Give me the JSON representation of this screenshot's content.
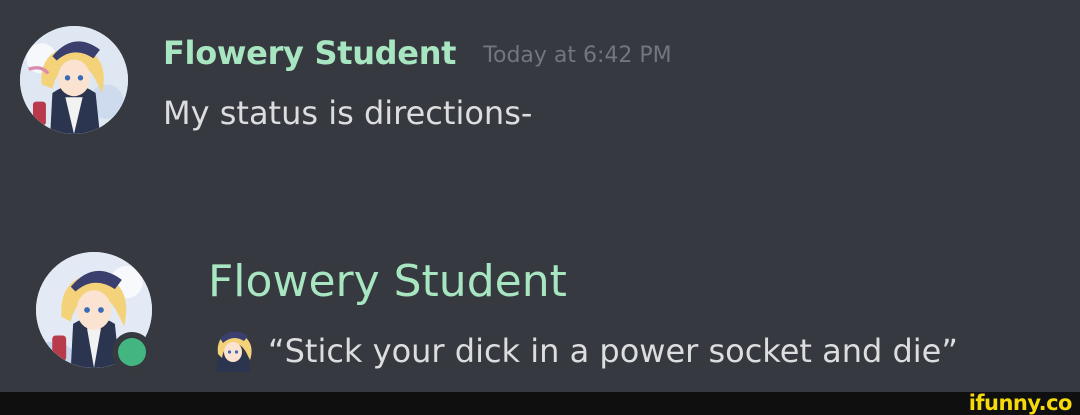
{
  "message": {
    "username": "Flowery Student",
    "timestamp": "Today at 6:42 PM",
    "content": "My status is directions-",
    "avatar_icon": "anime-character-avatar",
    "username_color": "#a8e6c2"
  },
  "profile": {
    "username": "Flowery Student",
    "avatar_icon": "anime-character-avatar",
    "status": "online",
    "status_color": "#43b581",
    "custom_status": {
      "emoji_icon": "anime-character-emoji",
      "text": "“Stick your dick in a power socket and die”"
    }
  },
  "watermark": {
    "text": "ifunny.co",
    "color": "#f5d90a"
  },
  "theme": {
    "background": "#36393f",
    "text": "#dcddde",
    "muted": "#72767d"
  }
}
